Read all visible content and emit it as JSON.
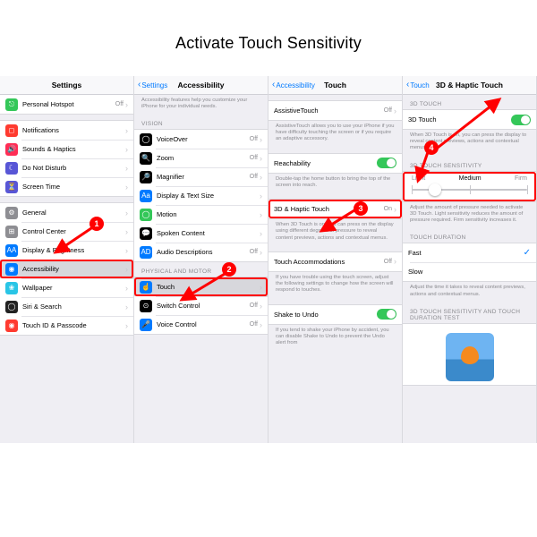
{
  "page_title": "Activate Touch Sensitivity",
  "col1": {
    "nav_title": "Settings",
    "items_a": [
      {
        "label": "Personal Hotspot",
        "value": "Off",
        "icon_color": "#34c759"
      }
    ],
    "items_b": [
      {
        "label": "Notifications",
        "icon_color": "#ff3b30"
      },
      {
        "label": "Sounds & Haptics",
        "icon_color": "#ff3b30"
      },
      {
        "label": "Do Not Disturb",
        "icon_color": "#5856d6"
      },
      {
        "label": "Screen Time",
        "icon_color": "#5856d6"
      }
    ],
    "items_c": [
      {
        "label": "General",
        "icon_color": "#8e8e93"
      },
      {
        "label": "Control Center",
        "icon_color": "#8e8e93"
      },
      {
        "label": "Display & Brightness",
        "icon_color": "#007aff"
      },
      {
        "label": "Accessibility",
        "icon_color": "#007aff",
        "highlight": true,
        "selected": true
      },
      {
        "label": "Wallpaper",
        "icon_color": "#29c5e6"
      },
      {
        "label": "Siri & Search",
        "icon_color": "#222"
      },
      {
        "label": "Touch ID & Passcode",
        "icon_color": "#ff3b30"
      }
    ]
  },
  "col2": {
    "back": "Settings",
    "nav_title": "Accessibility",
    "intro": "Accessibility features help you customize your iPhone for your individual needs.",
    "section_vision": "VISION",
    "vision_items": [
      {
        "label": "VoiceOver",
        "value": "Off",
        "icon_color": "#000"
      },
      {
        "label": "Zoom",
        "value": "Off",
        "icon_color": "#000"
      },
      {
        "label": "Magnifier",
        "value": "Off",
        "icon_color": "#000"
      },
      {
        "label": "Display & Text Size",
        "icon_color": "#007aff"
      },
      {
        "label": "Motion",
        "icon_color": "#34c759"
      },
      {
        "label": "Spoken Content",
        "icon_color": "#000"
      },
      {
        "label": "Audio Descriptions",
        "value": "Off",
        "icon_color": "#007aff"
      }
    ],
    "section_motor": "PHYSICAL AND MOTOR",
    "motor_items": [
      {
        "label": "Touch",
        "icon_color": "#007aff",
        "highlight": true,
        "selected": true
      },
      {
        "label": "Switch Control",
        "value": "Off",
        "icon_color": "#000"
      },
      {
        "label": "Voice Control",
        "value": "Off",
        "icon_color": "#007aff"
      }
    ]
  },
  "col3": {
    "back": "Accessibility",
    "nav_title": "Touch",
    "at_label": "AssistiveTouch",
    "at_value": "Off",
    "at_desc": "AssistiveTouch allows you to use your iPhone if you have difficulty touching the screen or if you require an adaptive accessory.",
    "reach_label": "Reachability",
    "reach_desc": "Double-tap the home button to bring the top of the screen into reach.",
    "hd_label": "3D & Haptic Touch",
    "hd_value": "On",
    "hd_desc": "When 3D Touch is on, you can press on the display using different degrees of pressure to reveal content previews, actions and contextual menus.",
    "ta_label": "Touch Accommodations",
    "ta_value": "Off",
    "ta_desc": "If you have trouble using the touch screen, adjust the following settings to change how the screen will respond to touches.",
    "su_label": "Shake to Undo",
    "su_desc": "If you tend to shake your iPhone by accident, you can disable Shake to Undo to prevent the Undo alert from"
  },
  "col4": {
    "back": "Touch",
    "nav_title": "3D & Haptic Touch",
    "section_3d": "3D TOUCH",
    "td_label": "3D Touch",
    "td_desc": "When 3D Touch is on, you can press the display to reveal content previews, actions and contextual menus.",
    "section_sens": "3D TOUCH SENSITIVITY",
    "sens_light": "Light",
    "sens_medium": "Medium",
    "sens_firm": "Firm",
    "sens_desc": "Adjust the amount of pressure needed to activate 3D Touch. Light sensitivity reduces the amount of pressure required. Firm sensitivity increases it.",
    "section_dur": "TOUCH DURATION",
    "dur_fast": "Fast",
    "dur_slow": "Slow",
    "dur_desc": "Adjust the time it takes to reveal content previews, actions and contextual menus.",
    "section_test": "3D TOUCH SENSITIVITY AND TOUCH DURATION TEST"
  },
  "markers": {
    "m1": "1",
    "m2": "2",
    "m3": "3",
    "m4": "4"
  }
}
